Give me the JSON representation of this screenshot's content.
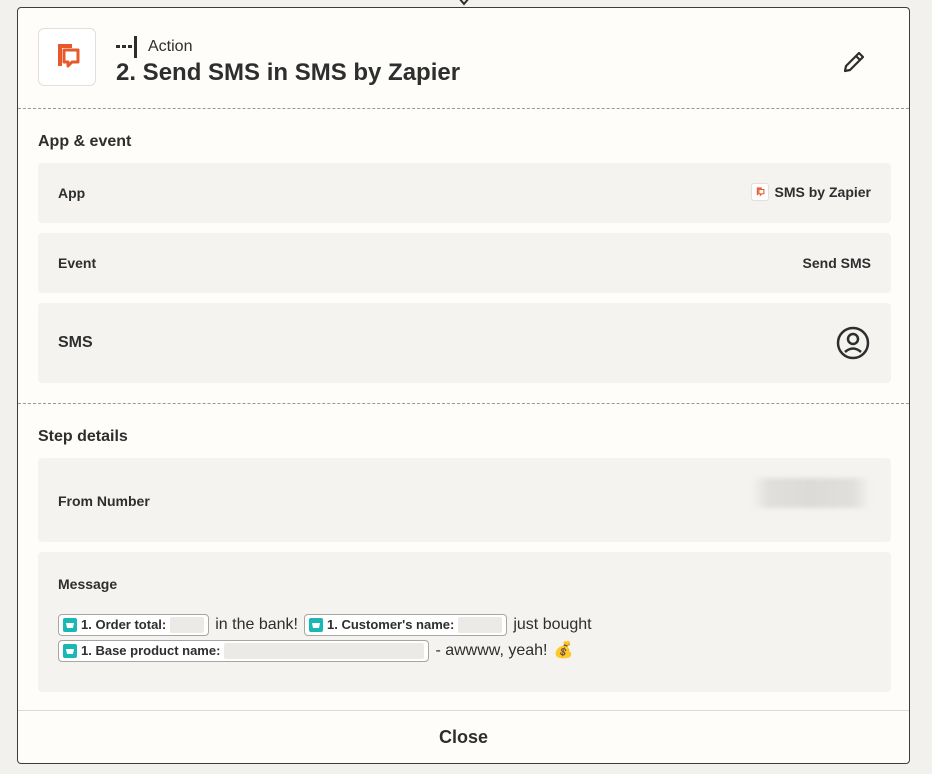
{
  "header": {
    "step_type": "Action",
    "title": "2. Send SMS in SMS by Zapier"
  },
  "app_event": {
    "section_title": "App & event",
    "app_label": "App",
    "app_value": "SMS by Zapier",
    "event_label": "Event",
    "event_value": "Send SMS",
    "account_label": "SMS"
  },
  "step_details": {
    "section_title": "Step details",
    "from_label": "From Number",
    "message_label": "Message",
    "message": {
      "pill_order_total": "1. Order total:",
      "text_in_bank": "in the bank!",
      "pill_customer_name": "1. Customer's name:",
      "text_just_bought": "just bought",
      "pill_product_name": "1. Base product name:",
      "text_yeah": "- awwww, yeah!",
      "emoji": "💰"
    }
  },
  "footer": {
    "close_label": "Close"
  },
  "colors": {
    "brand_orange": "#e8582b",
    "pill_teal": "#1bb7b5"
  }
}
